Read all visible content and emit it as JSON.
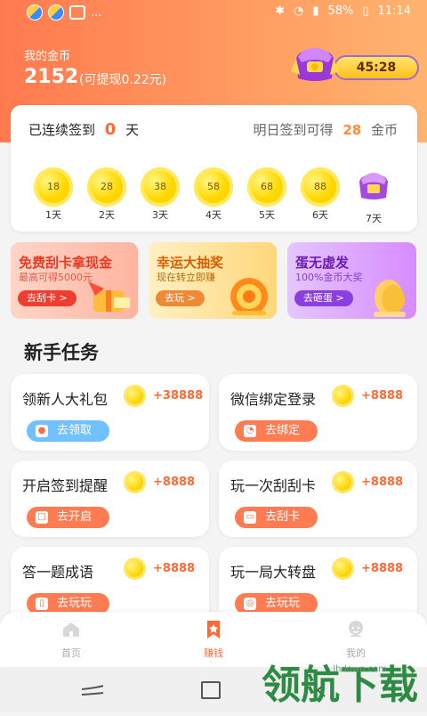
{
  "status": {
    "battery": "58%",
    "time": "11:14",
    "more": "..."
  },
  "header": {
    "coin_label": "我的金币",
    "coin_count": "2152",
    "cash_hint": "(可提现0.22元)",
    "timer": "45:28"
  },
  "signin": {
    "left_prefix": "已连续签到",
    "streak": "0",
    "left_suffix": "天",
    "right_prefix": "明日签到可得",
    "tomorrow": "28",
    "right_suffix": "金币",
    "days": [
      {
        "value": "18",
        "label": "1天"
      },
      {
        "value": "28",
        "label": "2天"
      },
      {
        "value": "38",
        "label": "3天"
      },
      {
        "value": "58",
        "label": "4天"
      },
      {
        "value": "68",
        "label": "5天"
      },
      {
        "value": "88",
        "label": "6天"
      },
      {
        "value": "",
        "label": "7天"
      }
    ]
  },
  "promos": [
    {
      "title": "免费刮卡拿现金",
      "subtitle": "最高可得5000元",
      "button": "去刮卡 >"
    },
    {
      "title": "幸运大抽奖",
      "subtitle": "现在转立即赚",
      "button": "去玩 >"
    },
    {
      "title": "蛋无虚发",
      "subtitle": "100%金币大奖",
      "button": "去砸蛋 >"
    }
  ],
  "section": {
    "title": "新手任务"
  },
  "tasks": [
    {
      "title": "领新人大礼包",
      "reward": "+38888",
      "button": "去领取"
    },
    {
      "title": "微信绑定登录",
      "reward": "+8888",
      "button": "去绑定"
    },
    {
      "title": "开启签到提醒",
      "reward": "+8888",
      "button": "去开启"
    },
    {
      "title": "玩一次刮刮卡",
      "reward": "+8888",
      "button": "去刮卡"
    },
    {
      "title": "答一题成语",
      "reward": "+8888",
      "button": "去玩玩"
    },
    {
      "title": "玩一局大转盘",
      "reward": "+8888",
      "button": "去玩玩"
    }
  ],
  "nav": {
    "home": "首页",
    "earn": "赚钱",
    "mine": "我的"
  },
  "watermark": {
    "main": "领航下载",
    "site": "lhdown.com"
  }
}
